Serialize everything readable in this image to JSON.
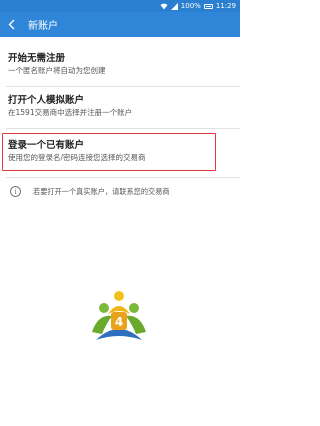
{
  "status_bar": {
    "battery": "100%",
    "time": "11:29"
  },
  "header": {
    "title": "新账户"
  },
  "options": [
    {
      "title": "开始无需注册",
      "subtitle": "一个匿名账户将自动为您创建"
    },
    {
      "title": "打开个人模拟账户",
      "subtitle": "在1591交易商中选择并注册一个账户"
    },
    {
      "title": "登录一个已有账户",
      "subtitle": "使用您的登录名/密码连接您选择的交易商"
    }
  ],
  "note": {
    "text": "若要打开一个真实账户，请联系您的交易商"
  },
  "logo": {
    "name": "metatrader-4-logo",
    "badge": "4"
  },
  "colors": {
    "app_bar": "#2f86d8",
    "status_bar": "#2a7fd0",
    "highlight": "#e23a3a"
  }
}
